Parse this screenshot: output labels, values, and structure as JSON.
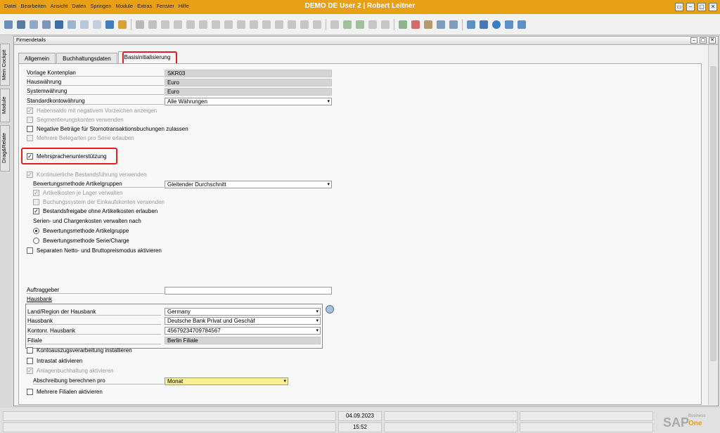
{
  "window": {
    "title": "DEMO DE User 2 | Robert Leitner",
    "controls": [
      "▭",
      "–",
      "▢",
      "✕"
    ]
  },
  "menu": [
    {
      "label": "Datei"
    },
    {
      "label": "Bearbeiten"
    },
    {
      "label": "Ansicht"
    },
    {
      "label": "Daten"
    },
    {
      "label": "Springen"
    },
    {
      "label": "Module"
    },
    {
      "label": "Extras"
    },
    {
      "label": "Fenster"
    },
    {
      "label": "Hilfe"
    }
  ],
  "side_tabs": [
    "Mein Cockpit",
    "Module",
    "Drag&Relate"
  ],
  "form": {
    "title": "Firmendetails",
    "tabs": [
      {
        "label": "Allgemein"
      },
      {
        "label": "Buchhaltungsdaten"
      },
      {
        "label": "Basisinitialisierung"
      }
    ],
    "active_tab": "Basisinitialisierung"
  },
  "fields": {
    "vorlage_kontenplan": {
      "label": "Vorlage Kontenplan",
      "value": "SKR03"
    },
    "hauswaehrung": {
      "label": "Hauswährung",
      "value": "Euro"
    },
    "systemwaehrung": {
      "label": "Systemwährung",
      "value": "Euro"
    },
    "standardkontowaehrung": {
      "label": "Standardkontowährung",
      "value": "Alle Währungen"
    },
    "bewertungsmethode": {
      "label": "Bewertungsmethode Artikelgruppen",
      "value": "Gleitender Durchschnitt"
    },
    "serien_label": "Serien- und Chargenkosten verwalten nach",
    "auftraggeber": {
      "label": "Auftraggeber",
      "value": ""
    },
    "hausbank_heading": "Hausbank",
    "land_region": {
      "label": "Land/Region der Hausbank",
      "value": "Germany"
    },
    "hausbank": {
      "label": "Hausbank",
      "value": "Deutsche Bank Privat und Geschäf"
    },
    "kontonr": {
      "label": "Kontonr. Hausbank",
      "value": "45679234709784567"
    },
    "filiale": {
      "label": "Filiale",
      "value": "Berlin Filiale"
    },
    "abschreibung": {
      "label": "Abschreibung berechnen pro",
      "value": "Monat"
    }
  },
  "checkboxes": {
    "habensaldo": {
      "label": "Habensaldo mit negativem Vorzeichen anzeigen",
      "checked": true,
      "disabled": true
    },
    "segmentierung": {
      "label": "Segmentierungskonten verwenden",
      "checked": false,
      "disabled": true
    },
    "negative_betraege": {
      "label": "Negative Beträge für Stornotransaktionsbuchungen zulassen",
      "checked": false,
      "disabled": false
    },
    "belegarten": {
      "label": "Mehrere Belegarten pro Serie erlauben",
      "checked": false,
      "disabled": true
    },
    "mehrsprachen": {
      "label": "Mehrsprachenunterstützung",
      "checked": true,
      "disabled": false
    },
    "bestandsfuehrung": {
      "label": "Kontinuierliche Bestandsführung verwenden",
      "checked": true,
      "disabled": true
    },
    "artikelkosten": {
      "label": "Artikelkosten je Lager verwalten",
      "checked": true,
      "disabled": true
    },
    "buchungssystem": {
      "label": "Buchungssystem der Einkaufskonten verwenden",
      "checked": false,
      "disabled": true
    },
    "bestandsfreigabe": {
      "label": "Bestandsfreigabe ohne Artikelkosten erlauben",
      "checked": true,
      "disabled": false
    },
    "netto_brutto": {
      "label": "Separaten Netto- und Bruttopreismodus aktivieren",
      "checked": false,
      "disabled": false
    },
    "kontoauszug": {
      "label": "Kontoauszugsverarbeitung installieren",
      "checked": false,
      "disabled": false
    },
    "intrastat": {
      "label": "Intrastat aktivieren",
      "checked": false,
      "disabled": false
    },
    "anlagenbuchhaltung": {
      "label": "Anlagenbuchhaltung aktivieren",
      "checked": true,
      "disabled": true
    },
    "mehrere_filialen": {
      "label": "Mehrere Filialen aktivieren",
      "checked": false,
      "disabled": false
    }
  },
  "radios": {
    "artikelgruppe": {
      "label": "Bewertungsmethode Artikelgruppe",
      "selected": true
    },
    "serie_charge": {
      "label": "Bewertungsmethode Serie/Charge",
      "selected": false
    }
  },
  "status": {
    "date": "04.09.2023",
    "time": "15:52",
    "logo": {
      "sap": "SAP",
      "business": "Business",
      "one": "One"
    }
  },
  "colors": {
    "title_bar": "#e8a117",
    "highlight": "#e02020",
    "yellow_field": "#fbef96"
  }
}
